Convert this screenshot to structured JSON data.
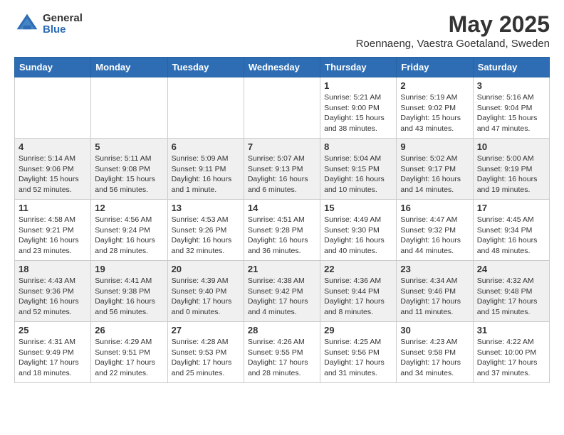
{
  "header": {
    "logo_general": "General",
    "logo_blue": "Blue",
    "title": "May 2025",
    "location": "Roennaeng, Vaestra Goetaland, Sweden"
  },
  "days_of_week": [
    "Sunday",
    "Monday",
    "Tuesday",
    "Wednesday",
    "Thursday",
    "Friday",
    "Saturday"
  ],
  "weeks": [
    [
      {
        "day": "",
        "info": ""
      },
      {
        "day": "",
        "info": ""
      },
      {
        "day": "",
        "info": ""
      },
      {
        "day": "",
        "info": ""
      },
      {
        "day": "1",
        "info": "Sunrise: 5:21 AM\nSunset: 9:00 PM\nDaylight: 15 hours\nand 38 minutes."
      },
      {
        "day": "2",
        "info": "Sunrise: 5:19 AM\nSunset: 9:02 PM\nDaylight: 15 hours\nand 43 minutes."
      },
      {
        "day": "3",
        "info": "Sunrise: 5:16 AM\nSunset: 9:04 PM\nDaylight: 15 hours\nand 47 minutes."
      }
    ],
    [
      {
        "day": "4",
        "info": "Sunrise: 5:14 AM\nSunset: 9:06 PM\nDaylight: 15 hours\nand 52 minutes."
      },
      {
        "day": "5",
        "info": "Sunrise: 5:11 AM\nSunset: 9:08 PM\nDaylight: 15 hours\nand 56 minutes."
      },
      {
        "day": "6",
        "info": "Sunrise: 5:09 AM\nSunset: 9:11 PM\nDaylight: 16 hours\nand 1 minute."
      },
      {
        "day": "7",
        "info": "Sunrise: 5:07 AM\nSunset: 9:13 PM\nDaylight: 16 hours\nand 6 minutes."
      },
      {
        "day": "8",
        "info": "Sunrise: 5:04 AM\nSunset: 9:15 PM\nDaylight: 16 hours\nand 10 minutes."
      },
      {
        "day": "9",
        "info": "Sunrise: 5:02 AM\nSunset: 9:17 PM\nDaylight: 16 hours\nand 14 minutes."
      },
      {
        "day": "10",
        "info": "Sunrise: 5:00 AM\nSunset: 9:19 PM\nDaylight: 16 hours\nand 19 minutes."
      }
    ],
    [
      {
        "day": "11",
        "info": "Sunrise: 4:58 AM\nSunset: 9:21 PM\nDaylight: 16 hours\nand 23 minutes."
      },
      {
        "day": "12",
        "info": "Sunrise: 4:56 AM\nSunset: 9:24 PM\nDaylight: 16 hours\nand 28 minutes."
      },
      {
        "day": "13",
        "info": "Sunrise: 4:53 AM\nSunset: 9:26 PM\nDaylight: 16 hours\nand 32 minutes."
      },
      {
        "day": "14",
        "info": "Sunrise: 4:51 AM\nSunset: 9:28 PM\nDaylight: 16 hours\nand 36 minutes."
      },
      {
        "day": "15",
        "info": "Sunrise: 4:49 AM\nSunset: 9:30 PM\nDaylight: 16 hours\nand 40 minutes."
      },
      {
        "day": "16",
        "info": "Sunrise: 4:47 AM\nSunset: 9:32 PM\nDaylight: 16 hours\nand 44 minutes."
      },
      {
        "day": "17",
        "info": "Sunrise: 4:45 AM\nSunset: 9:34 PM\nDaylight: 16 hours\nand 48 minutes."
      }
    ],
    [
      {
        "day": "18",
        "info": "Sunrise: 4:43 AM\nSunset: 9:36 PM\nDaylight: 16 hours\nand 52 minutes."
      },
      {
        "day": "19",
        "info": "Sunrise: 4:41 AM\nSunset: 9:38 PM\nDaylight: 16 hours\nand 56 minutes."
      },
      {
        "day": "20",
        "info": "Sunrise: 4:39 AM\nSunset: 9:40 PM\nDaylight: 17 hours\nand 0 minutes."
      },
      {
        "day": "21",
        "info": "Sunrise: 4:38 AM\nSunset: 9:42 PM\nDaylight: 17 hours\nand 4 minutes."
      },
      {
        "day": "22",
        "info": "Sunrise: 4:36 AM\nSunset: 9:44 PM\nDaylight: 17 hours\nand 8 minutes."
      },
      {
        "day": "23",
        "info": "Sunrise: 4:34 AM\nSunset: 9:46 PM\nDaylight: 17 hours\nand 11 minutes."
      },
      {
        "day": "24",
        "info": "Sunrise: 4:32 AM\nSunset: 9:48 PM\nDaylight: 17 hours\nand 15 minutes."
      }
    ],
    [
      {
        "day": "25",
        "info": "Sunrise: 4:31 AM\nSunset: 9:49 PM\nDaylight: 17 hours\nand 18 minutes."
      },
      {
        "day": "26",
        "info": "Sunrise: 4:29 AM\nSunset: 9:51 PM\nDaylight: 17 hours\nand 22 minutes."
      },
      {
        "day": "27",
        "info": "Sunrise: 4:28 AM\nSunset: 9:53 PM\nDaylight: 17 hours\nand 25 minutes."
      },
      {
        "day": "28",
        "info": "Sunrise: 4:26 AM\nSunset: 9:55 PM\nDaylight: 17 hours\nand 28 minutes."
      },
      {
        "day": "29",
        "info": "Sunrise: 4:25 AM\nSunset: 9:56 PM\nDaylight: 17 hours\nand 31 minutes."
      },
      {
        "day": "30",
        "info": "Sunrise: 4:23 AM\nSunset: 9:58 PM\nDaylight: 17 hours\nand 34 minutes."
      },
      {
        "day": "31",
        "info": "Sunrise: 4:22 AM\nSunset: 10:00 PM\nDaylight: 17 hours\nand 37 minutes."
      }
    ]
  ]
}
